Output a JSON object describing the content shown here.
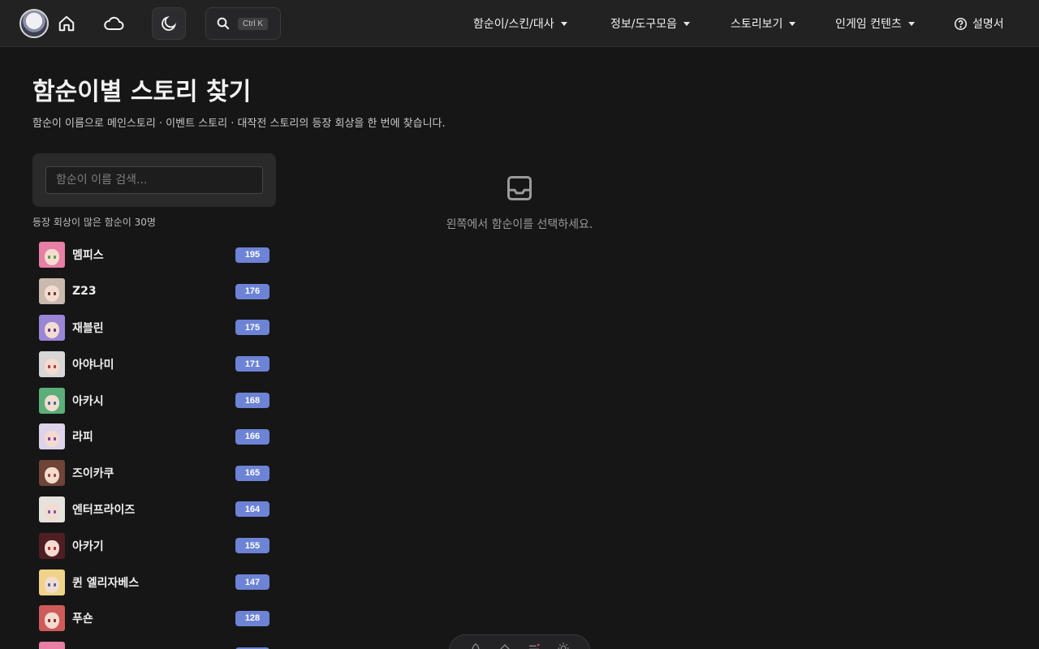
{
  "nav": {
    "logo": "site-logo",
    "home_icon": "home-icon",
    "cloud_icon": "cloud-icon",
    "theme_icon": "moon-icon",
    "search_shortcut": "Ctrl K",
    "menus": [
      {
        "label": "함순이/스킨/대사"
      },
      {
        "label": "정보/도구모음"
      },
      {
        "label": "스토리보기"
      },
      {
        "label": "인게임 컨텐츠"
      }
    ],
    "help_label": "설명서"
  },
  "page": {
    "title": "함순이별 스토리 찾기",
    "subtitle": "함순이 이름으로 메인스토리 · 이벤트 스토리 · 대작전 스토리의 등장 회상을 한 번에 찾습니다."
  },
  "search": {
    "placeholder": "함순이 이름 검색..."
  },
  "list": {
    "caption": "등장 회상이 많은 함순이 30명",
    "items": [
      {
        "name": "멤피스",
        "count": "195",
        "hair": "#e87fa6",
        "eye": "#5a9a4a"
      },
      {
        "name": "Z23",
        "count": "176",
        "hair": "#c9b9ae",
        "eye": "#6a3a2a"
      },
      {
        "name": "재블린",
        "count": "175",
        "hair": "#9a86d6",
        "eye": "#5a3a8a"
      },
      {
        "name": "아야나미",
        "count": "171",
        "hair": "#d8d6d6",
        "eye": "#b03a3a"
      },
      {
        "name": "아카시",
        "count": "168",
        "hair": "#5cae7a",
        "eye": "#3a6a9a"
      },
      {
        "name": "라피",
        "count": "166",
        "hair": "#ddd3ea",
        "eye": "#8a3aa6"
      },
      {
        "name": "즈이카쿠",
        "count": "165",
        "hair": "#6e4436",
        "eye": "#a0483a"
      },
      {
        "name": "엔터프라이즈",
        "count": "164",
        "hair": "#e6e2dc",
        "eye": "#6a5ab0"
      },
      {
        "name": "아카기",
        "count": "155",
        "hair": "#4e1e24",
        "eye": "#b02a2a"
      },
      {
        "name": "퀸 엘리자베스",
        "count": "147",
        "hair": "#f0d28a",
        "eye": "#3a6ab0"
      },
      {
        "name": "푸숀",
        "count": "128",
        "hair": "#cf5a5a",
        "eye": "#8a2a2a"
      },
      {
        "name": "",
        "count": "",
        "hair": "#e87fa6",
        "eye": "#5a9a4a"
      }
    ]
  },
  "empty": {
    "icon": "inbox-icon",
    "message": "왼쪽에서 함순이를 선택하세요."
  },
  "toolbar": {
    "icons": [
      "pen-icon",
      "eraser-icon",
      "lines-icon",
      "gear-icon"
    ]
  },
  "colors": {
    "accent": "#6c83d6",
    "background": "#161616",
    "topbar": "#222222"
  }
}
